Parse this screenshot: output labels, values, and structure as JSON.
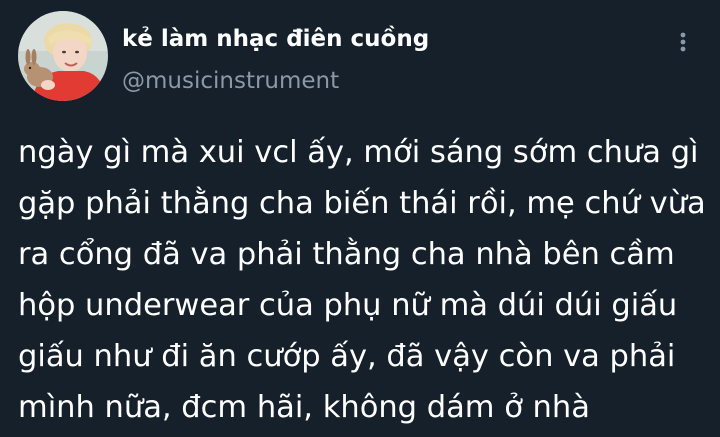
{
  "author": {
    "display_name": "kẻ làm nhạc điên cuồng",
    "handle": "@musicinstrument",
    "avatar_icon": "profile-photo"
  },
  "actions": {
    "more_icon": "vertical-ellipsis-icon"
  },
  "tweet": {
    "lines": [
      "ngày gì mà xui vcl ấy, mới sáng sớm chưa gì",
      "gặp phải thằng cha biến thái rồi, mẹ chứ vừa",
      "ra cổng đã va phải thằng cha nhà bên cầm",
      "hộp underwear của phụ nữ mà dúi dúi giấu",
      "giấu như đi ăn cướp ấy, đã vậy còn va phải",
      "mình nữa, đcm hãi, không dám ở nhà"
    ]
  },
  "colors": {
    "background": "#15202b",
    "name": "#ffffff",
    "handle": "#8b98a5",
    "text": "#ffffff"
  }
}
